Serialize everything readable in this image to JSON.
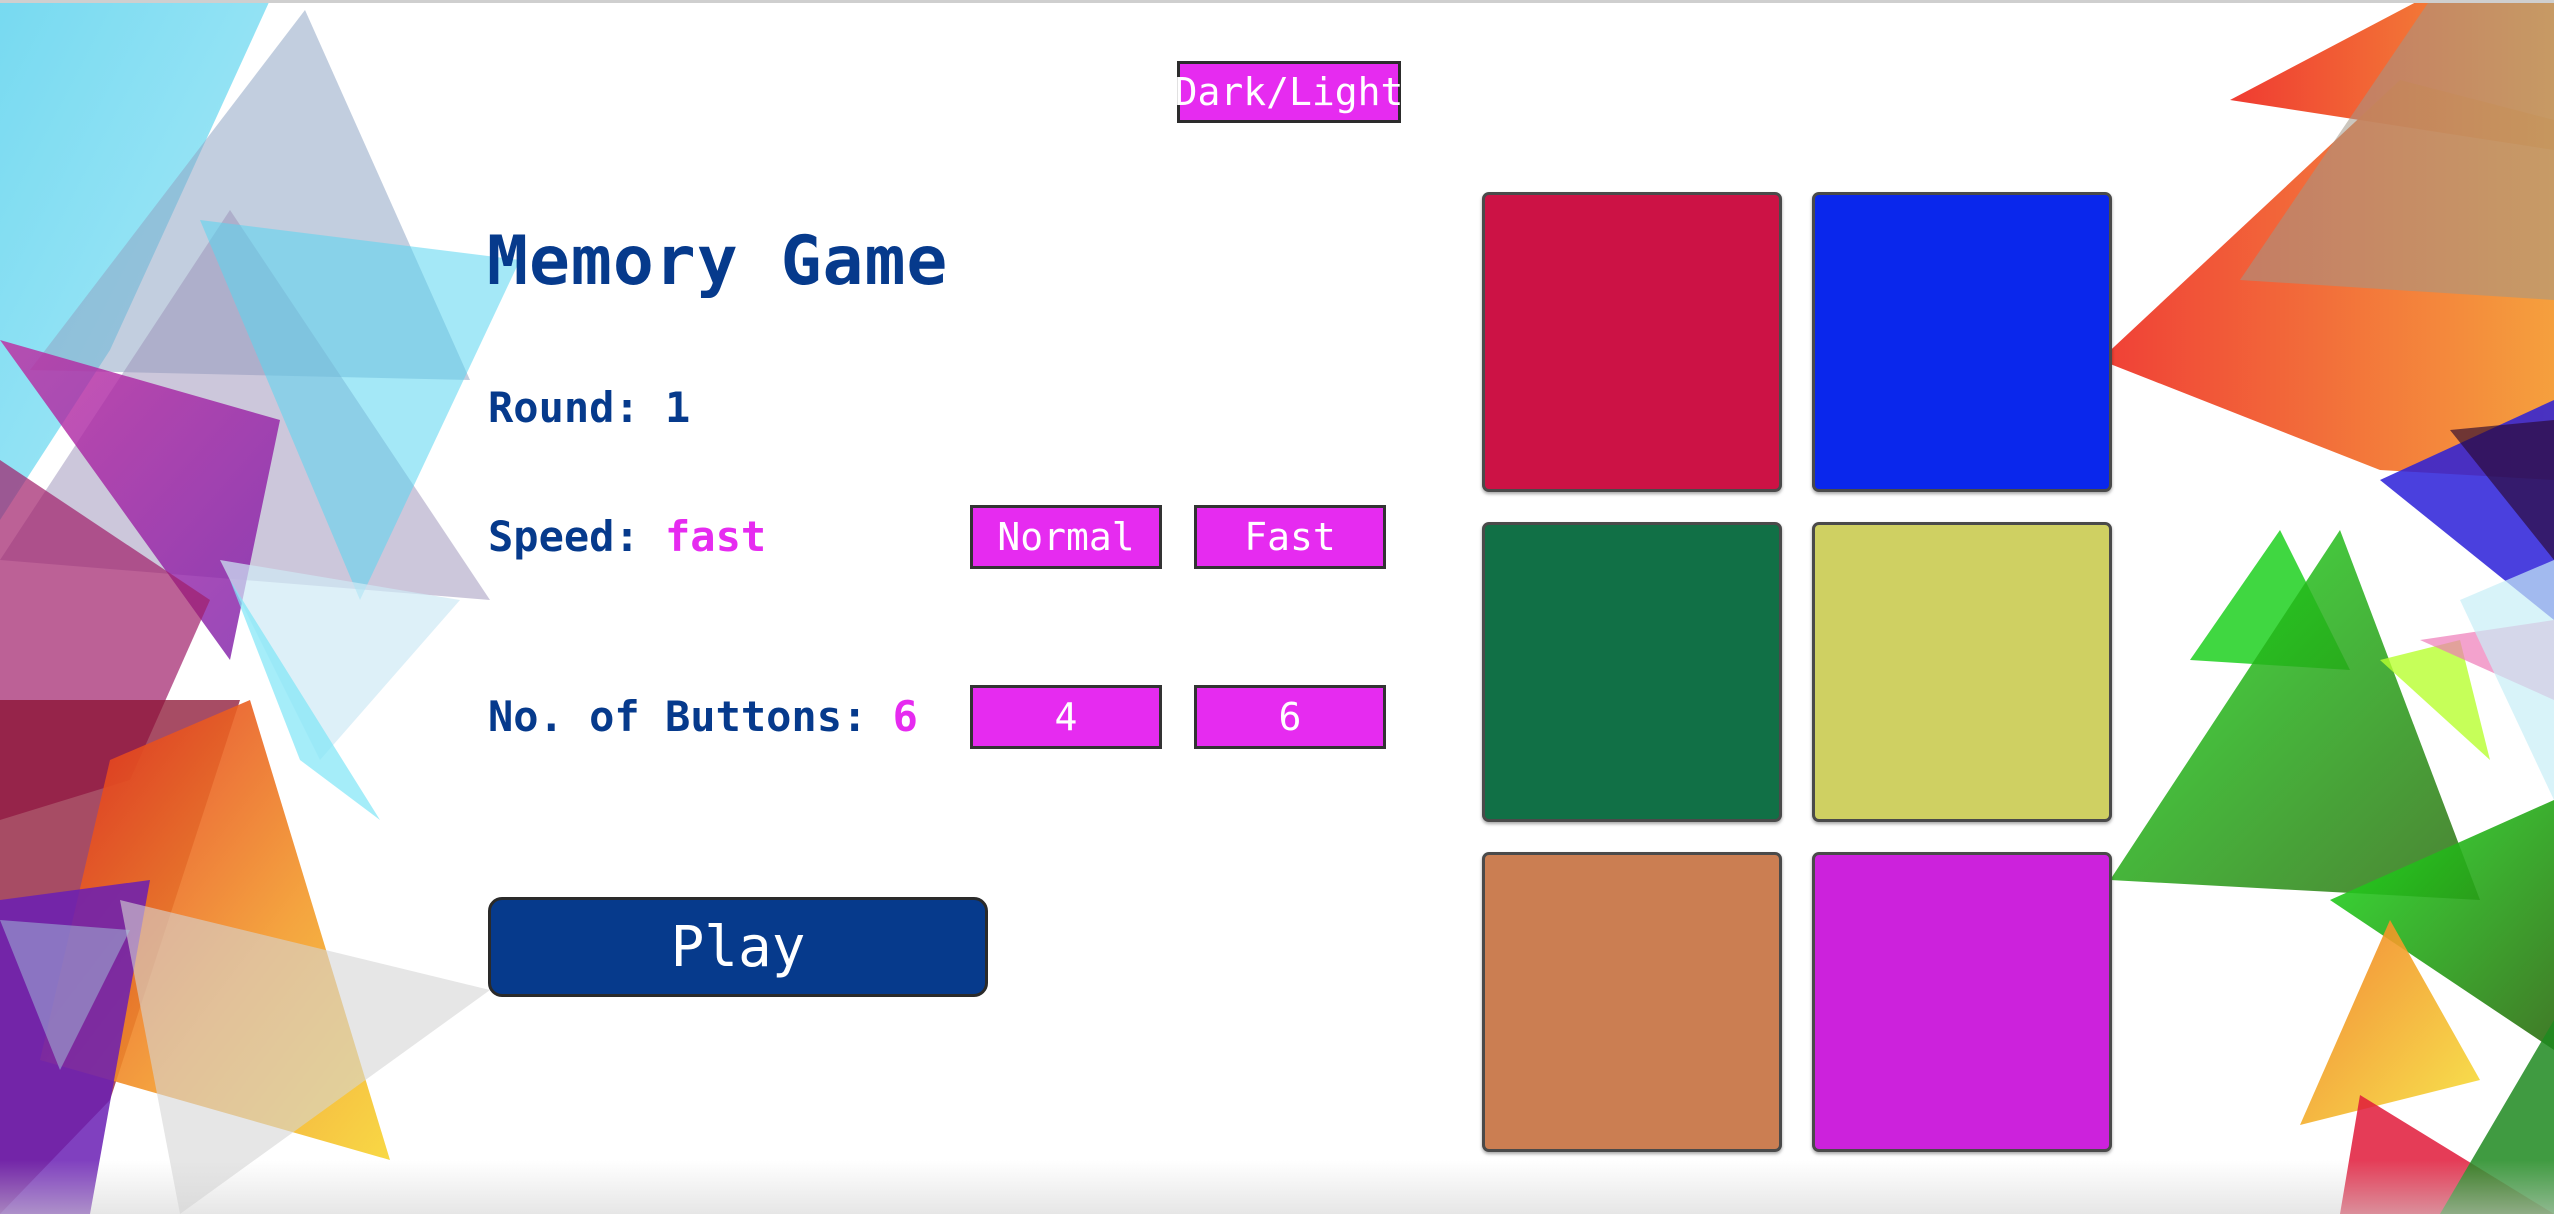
{
  "header": {
    "theme_toggle_label": "Dark/Light"
  },
  "game": {
    "title": "Memory Game",
    "round_label": "Round: ",
    "round_value": "1",
    "speed_label": "Speed: ",
    "speed_value": "fast",
    "buttons_label": "No. of Buttons: ",
    "buttons_value": "6"
  },
  "speed_options": [
    {
      "label": "Normal"
    },
    {
      "label": "Fast"
    }
  ],
  "button_count_options": [
    {
      "label": "4"
    },
    {
      "label": "6"
    }
  ],
  "play_label": "Play",
  "tiles": [
    {
      "color": "#cc1245"
    },
    {
      "color": "#0a27ec"
    },
    {
      "color": "#117046"
    },
    {
      "color": "#cfd062"
    },
    {
      "color": "#cb7e52"
    },
    {
      "color": "#cc22dc"
    }
  ],
  "colors": {
    "primary_text": "#063a8c",
    "accent": "#e62bf0",
    "option_bg": "#e62bf0",
    "play_bg": "#063a8c"
  }
}
